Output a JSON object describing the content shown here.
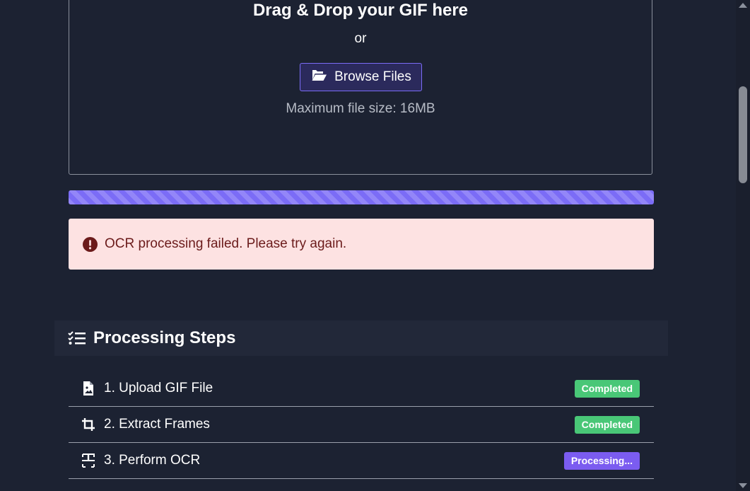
{
  "upload": {
    "title": "Drag & Drop your GIF here",
    "or_text": "or",
    "browse_label": "Browse Files",
    "max_size": "Maximum file size: 16MB"
  },
  "progress": {
    "value_percent": 100,
    "color": "#7b6cf6"
  },
  "alert": {
    "icon": "exclamation-circle-icon",
    "message": "OCR processing failed. Please try again."
  },
  "steps": {
    "title": "Processing Steps",
    "icon": "list-check-icon",
    "items": [
      {
        "label": "1. Upload GIF File",
        "icon": "file-image-icon",
        "status": "Completed"
      },
      {
        "label": "2. Extract Frames",
        "icon": "crop-icon",
        "status": "Completed"
      },
      {
        "label": "3. Perform OCR",
        "icon": "text-scan-icon",
        "status": "Processing..."
      }
    ]
  },
  "colors": {
    "background": "#1c2232",
    "accent": "#7b6cf6",
    "success": "#49c777",
    "danger_bg": "#fde2e2",
    "danger_text": "#6b1b1b"
  }
}
